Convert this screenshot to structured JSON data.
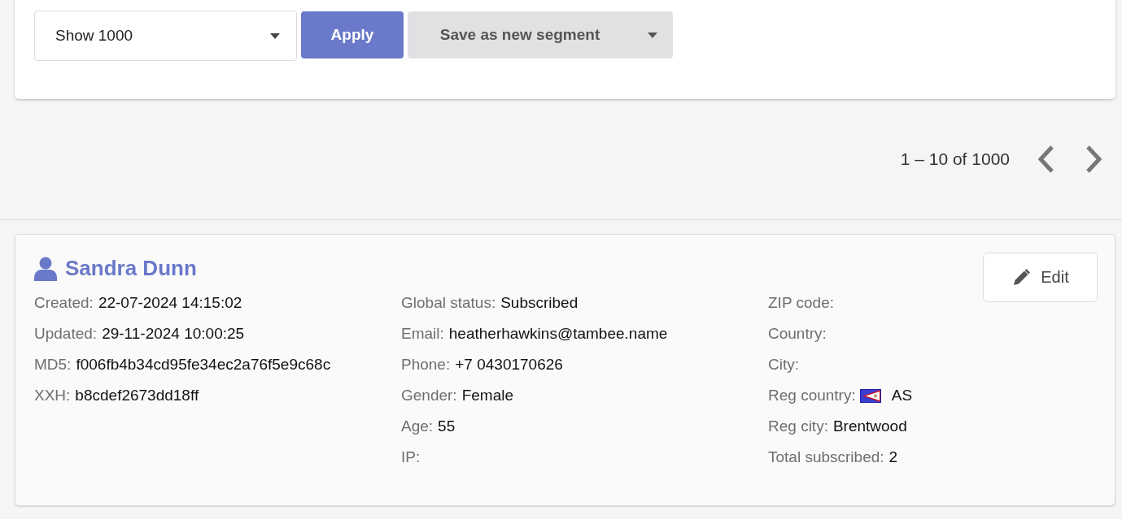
{
  "filter_card": {
    "limit_select": {
      "value": "Show 1000"
    },
    "apply_button": "Apply",
    "save_button": "Save as new segment"
  },
  "pagination": {
    "range": "1 – 10 of 1000",
    "prev_disabled": false,
    "next_disabled": false
  },
  "contact": {
    "name": "Sandra Dunn",
    "edit_button": "Edit",
    "columns": [
      [
        {
          "label": "Created:",
          "value": "22-07-2024 14:15:02"
        },
        {
          "label": "Updated:",
          "value": "29-11-2024 10:00:25"
        },
        {
          "label": "MD5:",
          "value": "f006fb4b34cd95fe34ec2a76f5e9c68c"
        },
        {
          "label": "XXH:",
          "value": "b8cdef2673dd18ff"
        }
      ],
      [
        {
          "label": "Global status:",
          "value": "Subscribed"
        },
        {
          "label": "Email:",
          "value": "heatherhawkins@tambee.name"
        },
        {
          "label": "Phone:",
          "value": "+7 0430170626"
        },
        {
          "label": "Gender:",
          "value": "Female"
        },
        {
          "label": "Age:",
          "value": "55"
        },
        {
          "label": "IP:"
        }
      ],
      [
        {
          "label": "ZIP code:"
        },
        {
          "label": "Country:"
        },
        {
          "label": "City:"
        },
        {
          "label": "Reg country:",
          "value": "AS",
          "kind": "flag"
        },
        {
          "label": "Reg city:",
          "value": "Brentwood"
        },
        {
          "label": "Total subscribed:",
          "value": "2"
        }
      ]
    ]
  }
}
